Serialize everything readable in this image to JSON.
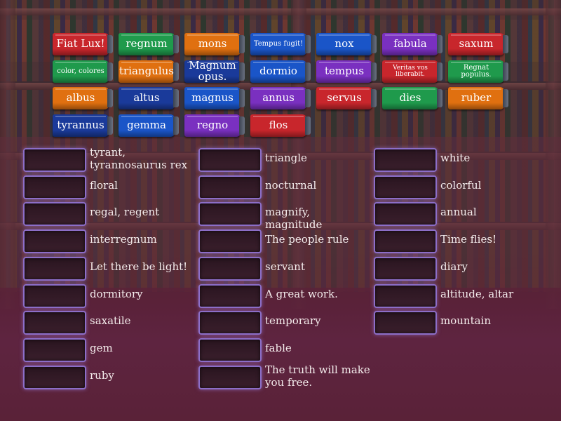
{
  "colors": {
    "red": "#c8262c",
    "green": "#1f9a4c",
    "orange": "#e07010",
    "blue": "#1a55c8",
    "navy": "#1a3a9a",
    "purple": "#7a30c0",
    "slot_border": "#8c6ec8"
  },
  "books": [
    {
      "label": "Fiat Lux!",
      "color": "red"
    },
    {
      "label": "regnum",
      "color": "green"
    },
    {
      "label": "mons",
      "color": "orange"
    },
    {
      "label": "Tempus fugit!",
      "color": "blue"
    },
    {
      "label": "nox",
      "color": "blue"
    },
    {
      "label": "fabula",
      "color": "purple"
    },
    {
      "label": "saxum",
      "color": "red"
    },
    {
      "label": "color, colores",
      "color": "green"
    },
    {
      "label": "triangulus",
      "color": "orange"
    },
    {
      "label": "Magnum opus.",
      "color": "navy"
    },
    {
      "label": "dormio",
      "color": "blue"
    },
    {
      "label": "tempus",
      "color": "purple"
    },
    {
      "label": "Veritas vos liberabit.",
      "color": "red"
    },
    {
      "label": "Regnat populus.",
      "color": "green"
    },
    {
      "label": "albus",
      "color": "orange"
    },
    {
      "label": "altus",
      "color": "navy"
    },
    {
      "label": "magnus",
      "color": "blue"
    },
    {
      "label": "annus",
      "color": "purple"
    },
    {
      "label": "servus",
      "color": "red"
    },
    {
      "label": "dies",
      "color": "green"
    },
    {
      "label": "ruber",
      "color": "orange"
    },
    {
      "label": "tyrannus",
      "color": "navy"
    },
    {
      "label": "gemma",
      "color": "blue"
    },
    {
      "label": "regno",
      "color": "purple"
    },
    {
      "label": "flos",
      "color": "red"
    }
  ],
  "clues": {
    "col1": [
      "tyrant, tyrannosaurus rex",
      "floral",
      "regal, regent",
      "interregnum",
      "Let there be light!",
      "dormitory",
      "saxatile",
      "gem",
      "ruby"
    ],
    "col2": [
      "triangle",
      "nocturnal",
      "magnify, magnitude",
      "The people rule",
      "servant",
      "A great work.",
      "temporary",
      "fable",
      "The truth will make you free."
    ],
    "col3": [
      "white",
      "colorful",
      "annual",
      "Time flies!",
      "diary",
      "altitude, altar",
      "mountain"
    ]
  }
}
